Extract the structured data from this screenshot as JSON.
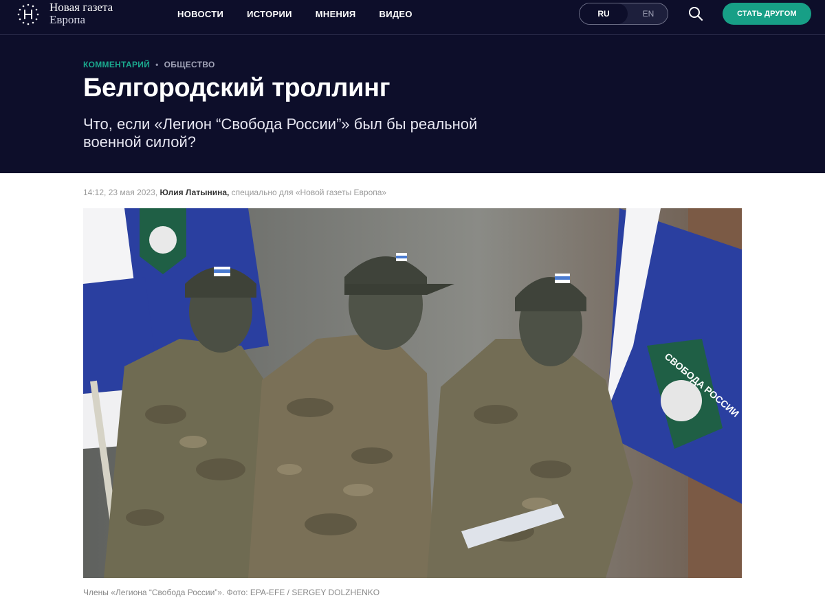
{
  "header": {
    "brand_line1": "Новая газета",
    "brand_line2": "Европа",
    "nav": [
      "НОВОСТИ",
      "ИСТОРИИ",
      "МНЕНИЯ",
      "ВИДЕО"
    ],
    "lang_ru": "RU",
    "lang_en": "EN",
    "cta": "СТАТЬ ДРУГОМ"
  },
  "article": {
    "category": "КОММЕНТАРИЙ",
    "section": "ОБЩЕСТВО",
    "title": "Белгородский троллинг",
    "subtitle": "Что, если «Легион “Свобода России”» был бы реальной военной силой?",
    "time": "14:12, 23 мая 2023,",
    "author": "Юлия Латынина,",
    "author_note": "специально для «Новой газеты Европа»",
    "caption": "Члены «Легиона “Свобода России”». Фото: EPA-EFE / SERGEY DOLZHENKO",
    "flag_patch_text": "СВОБОДА РОССИИ"
  },
  "colors": {
    "header_bg": "#0d0e2a",
    "accent": "#179f86",
    "flag_blue": "#2a3fa0"
  },
  "icons": {
    "logo": "star-ring-logo",
    "search": "search-icon"
  }
}
